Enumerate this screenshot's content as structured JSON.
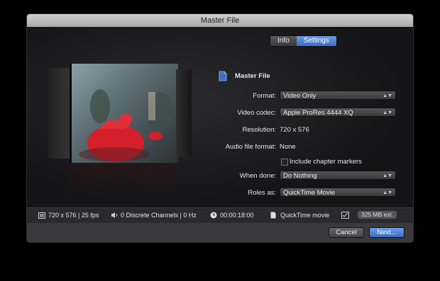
{
  "window": {
    "title": "Master File"
  },
  "tabs": [
    {
      "label": "Info",
      "active": false
    },
    {
      "label": "Settings",
      "active": true
    }
  ],
  "header": {
    "title": "Master File",
    "icon": "document-icon"
  },
  "fields": {
    "format": {
      "label": "Format:",
      "value": "Video Only"
    },
    "video_codec": {
      "label": "Video codec:",
      "value": "Apple ProRes 4444 XQ"
    },
    "resolution": {
      "label": "Resolution:",
      "value": "720 x 576"
    },
    "audio_file_format": {
      "label": "Audio file format:",
      "value": "None"
    },
    "chapter_markers": {
      "label": "Include chapter markers",
      "checked": false
    },
    "when_done": {
      "label": "When done:",
      "value": "Do Nothing"
    },
    "roles_as": {
      "label": "Roles as:",
      "value": "QuickTime Movie"
    }
  },
  "status": {
    "video": "720 x 576 | 25 fps",
    "audio": "0 Discrete Channels | 0 Hz",
    "duration": "00:00:18:00",
    "file_type": "QuickTime movie",
    "size": "325 MB est."
  },
  "buttons": {
    "cancel": "Cancel",
    "next": "Next..."
  },
  "colors": {
    "accent": "#3c6fc4",
    "window_bg": "#1c1c1e"
  }
}
